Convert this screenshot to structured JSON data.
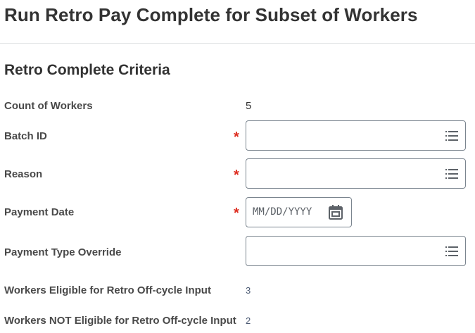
{
  "page": {
    "title": "Run Retro Pay Complete for Subset of Workers"
  },
  "section": {
    "title": "Retro Complete Criteria"
  },
  "required_marker": "*",
  "fields": {
    "count_of_workers": {
      "label": "Count of Workers",
      "value": "5"
    },
    "batch_id": {
      "label": "Batch ID",
      "value": "",
      "icon": "prompt-list-icon"
    },
    "reason": {
      "label": "Reason",
      "value": "",
      "icon": "prompt-list-icon"
    },
    "payment_date": {
      "label": "Payment Date",
      "placeholder": "MM/DD/YYYY",
      "icon": "calendar-icon"
    },
    "payment_type_override": {
      "label": "Payment Type Override",
      "value": "",
      "icon": "prompt-list-icon"
    },
    "eligible": {
      "label": "Workers Eligible for Retro Off-cycle Input",
      "value": "3"
    },
    "not_eligible": {
      "label": "Workers NOT Eligible for Retro Off-cycle Input",
      "value": "2"
    }
  },
  "colors": {
    "required": "#de2e21",
    "link_value": "#4c5a73",
    "input_border": "#7b858f"
  }
}
